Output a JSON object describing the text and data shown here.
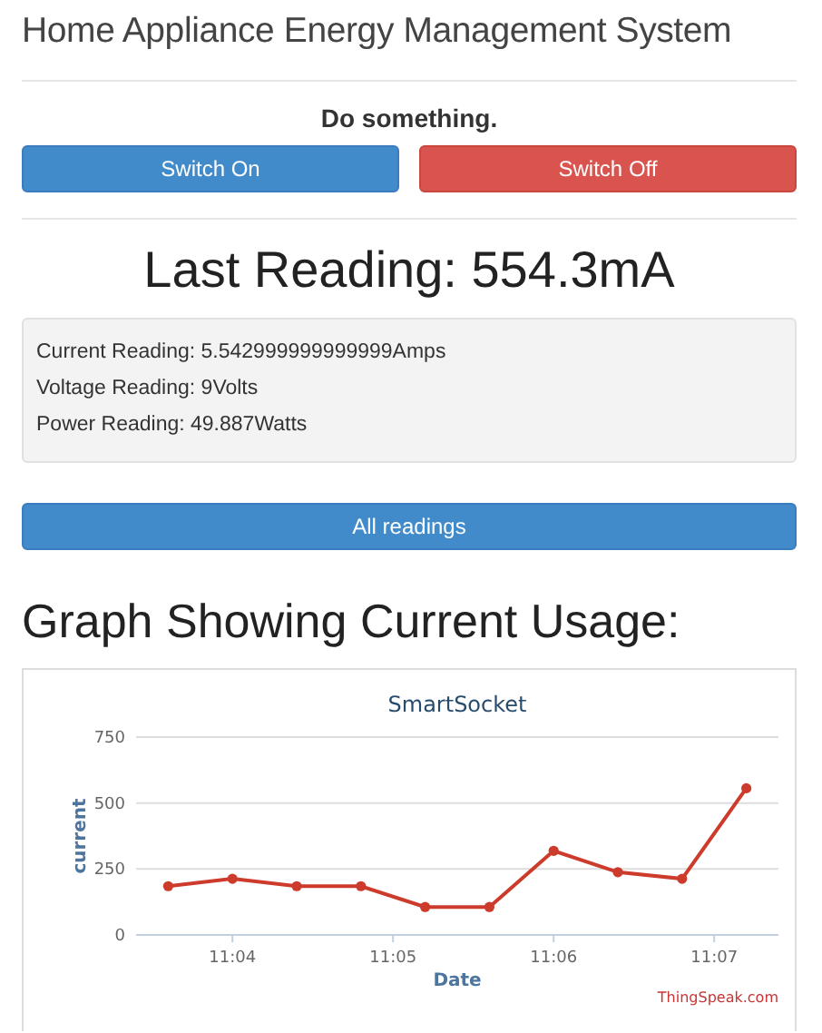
{
  "header": {
    "title": "Home Appliance Energy Management System"
  },
  "controls": {
    "heading": "Do something.",
    "buttons": [
      {
        "label": "Switch On",
        "kind": "primary"
      },
      {
        "label": "Switch Off",
        "kind": "danger"
      }
    ]
  },
  "last_reading": {
    "heading": "Last Reading: 554.3mA",
    "lines": [
      "Current Reading: 5.542999999999999Amps",
      "Voltage Reading: 9Volts",
      "Power Reading: 49.887Watts"
    ]
  },
  "all_readings_button": "All readings",
  "graph": {
    "heading": "Graph Showing Current Usage:",
    "credit": "ThingSpeak.com",
    "chart_data": {
      "type": "line",
      "title": "SmartSocket",
      "xlabel": "Date",
      "ylabel": "current",
      "categories": [
        null,
        null,
        null,
        null,
        null,
        null,
        null,
        null,
        null,
        null
      ],
      "series": [
        {
          "marker": "circle",
          "color": "#cc3b2b",
          "values": [
            185,
            213,
            185,
            185,
            106,
            106,
            319,
            238,
            213,
            556
          ]
        }
      ],
      "ylim": [
        0,
        750
      ],
      "yticks": [
        0,
        250,
        500,
        750
      ]
    },
    "x_axis_labels": [
      "11:04",
      "11:05",
      "11:06",
      "11:07"
    ]
  }
}
